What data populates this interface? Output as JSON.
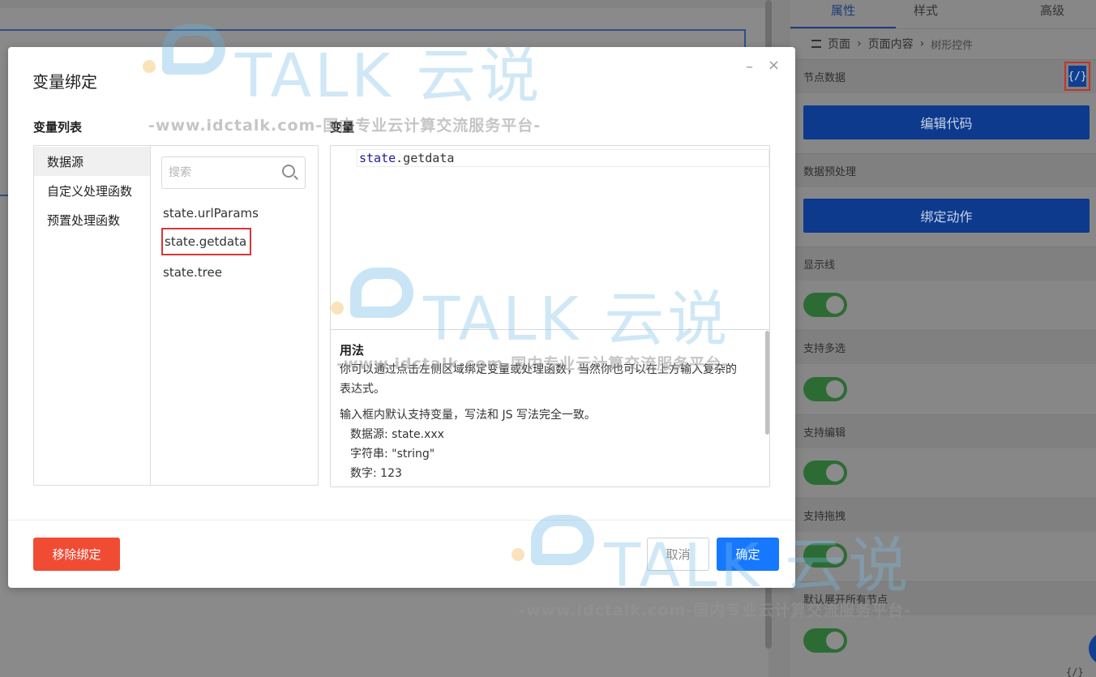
{
  "right_panel": {
    "tabs": [
      "属性",
      "样式",
      "高级"
    ],
    "breadcrumb": [
      "页面",
      "页面内容",
      "树形控件"
    ],
    "rows": {
      "node_data": "节点数据",
      "data_preprocess": "数据预处理",
      "show_line": "显示线",
      "multi_select": "支持多选",
      "edit": "支持编辑",
      "drag": "支持拖拽",
      "expand_all": "默认展开所有节点"
    },
    "code_icon": "{/}",
    "edit_code_btn": "编辑代码",
    "bind_action_btn": "绑定动作",
    "bottom_icon": "{/}"
  },
  "dialog": {
    "title": "变量绑定",
    "var_list_label": "变量列表",
    "var_label": "变量",
    "categories": [
      "数据源",
      "自定义处理函数",
      "预置处理函数"
    ],
    "search_placeholder": "搜索",
    "variables": [
      "state.urlParams",
      "state.getdata",
      "state.tree"
    ],
    "editor": {
      "keyword": "state",
      "rest": ".getdata"
    },
    "help": {
      "title": "用法",
      "p1": "你可以通过点击左侧区域绑定变量或处理函数，当然你也可以在上方输入复杂的表达式。",
      "p2": "输入框内默认支持变量，写法和 JS 写法完全一致。",
      "lines": [
        "数据源: state.xxx",
        "字符串: \"string\"",
        "数字: 123"
      ]
    },
    "remove_btn": "移除绑定",
    "cancel_btn": "取消",
    "ok_btn": "确定",
    "min_icon": "–",
    "close_icon": "×"
  },
  "watermark": {
    "logo": "TALK 云说",
    "url": "-www.idctalk.com-国内专业云计算交流服务平台-"
  }
}
